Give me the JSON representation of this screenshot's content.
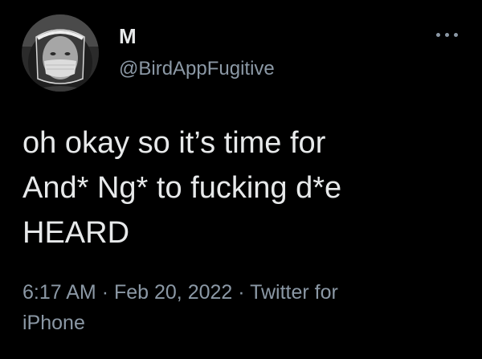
{
  "user": {
    "display_name": "M",
    "handle": "@BirdAppFugitive",
    "avatar": "profile-photo"
  },
  "actions": {
    "more_icon": "more-horizontal-icon"
  },
  "tweet": {
    "lines": [
      "oh okay so it’s time for",
      "And* Ng* to fucking d*e",
      "HEARD"
    ]
  },
  "meta": {
    "time": "6:17 AM",
    "separator": "·",
    "date": "Feb 20, 2022",
    "source_prefix": "Twitter for",
    "source_device": "iPhone"
  },
  "colors": {
    "background": "#000000",
    "primary_text": "#e7e9ea",
    "secondary_text": "#8b98a5"
  }
}
